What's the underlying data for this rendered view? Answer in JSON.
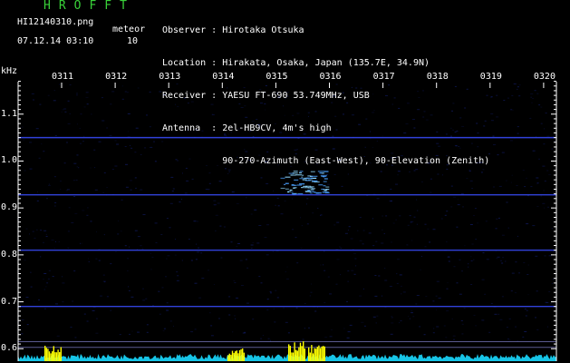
{
  "header": {
    "brand": "HROFFT",
    "filename": "HI12140310.png",
    "meteor_label": "meteor",
    "datetime": "07.12.14 03:10",
    "meteor_count": "10"
  },
  "info": {
    "lines": [
      "Observer : Hirotaka Otsuka",
      "Location : Hirakata, Osaka, Japan (135.7E, 34.9N)",
      "Receiver : YAESU FT-690 53.749MHz, USB",
      "Antenna  : 2el-HB9CV, 4m's high",
      "           90-270-Azimuth (East-West), 90-Elevation (Zenith)"
    ]
  },
  "chart_data": {
    "type": "heatmap",
    "ylabel": "kHz",
    "x_tick_labels": [
      "0311",
      "0312",
      "0313",
      "0314",
      "0315",
      "0316",
      "0317",
      "0318",
      "0319",
      "0320"
    ],
    "y_tick_labels": [
      "1.1",
      "1.0",
      "0.9",
      "0.8",
      "0.7",
      "0.6"
    ],
    "y_ticks": [
      1.1,
      1.0,
      0.9,
      0.8,
      0.7,
      0.6
    ],
    "ylim": [
      0.585,
      1.175
    ],
    "horizontal_lines_khz": [
      1.05,
      0.928,
      0.81,
      0.69,
      0.615,
      0.603
    ],
    "meteor_echo": {
      "time": "0315",
      "freq_khz": 0.955
    },
    "colors": {
      "background": "#000000",
      "text": "#ffffff",
      "brand": "#39d139",
      "lines": "#3a4dff",
      "echo": "#8fd8ff",
      "spectrum": "#19d9ff",
      "peaks": "#ffff00"
    }
  }
}
